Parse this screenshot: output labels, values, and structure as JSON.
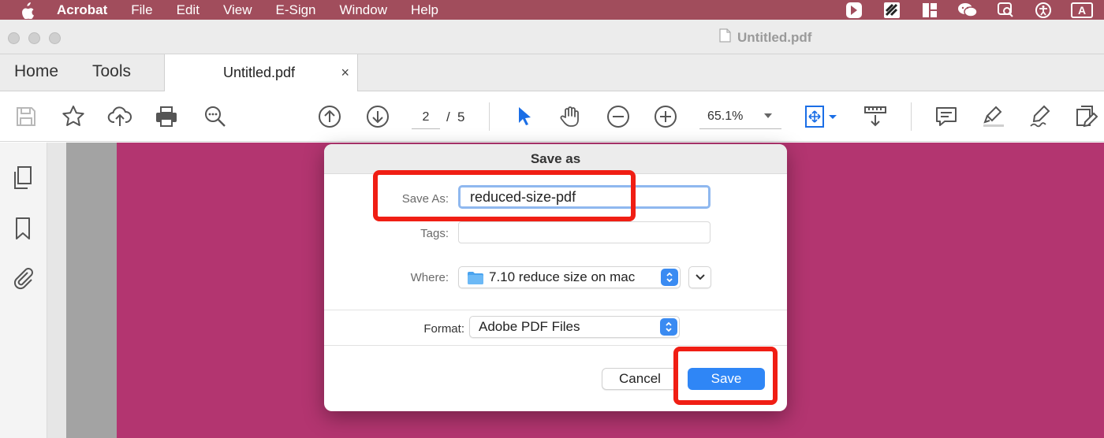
{
  "menubar": {
    "app_name": "Acrobat",
    "items": [
      "File",
      "Edit",
      "View",
      "E-Sign",
      "Window",
      "Help"
    ],
    "keyboard_input": "A",
    "status_icons": [
      "acrobat-status-icon",
      "qr-app-icon",
      "layout-icon",
      "wechat-icon",
      "chat-search-icon",
      "accessibility-icon"
    ]
  },
  "window": {
    "title": "Untitled.pdf"
  },
  "tabs": {
    "home": "Home",
    "tools": "Tools",
    "doc": "Untitled.pdf",
    "close": "×"
  },
  "toolbar": {
    "page_current": "2",
    "page_separator": "/",
    "page_total": "5",
    "zoom": "65.1%"
  },
  "dialog": {
    "title": "Save as",
    "save_as_label": "Save As:",
    "filename": "reduced-size-pdf",
    "tags_label": "Tags:",
    "tags_value": "",
    "where_label": "Where:",
    "where_value": "7.10 reduce size on mac",
    "format_label": "Format:",
    "format_value": "Adobe PDF Files",
    "cancel": "Cancel",
    "save": "Save"
  },
  "colors": {
    "menubar": "#a14d5c",
    "page": "#b33570",
    "accent": "#2f86f6",
    "highlight": "#f01e14"
  }
}
